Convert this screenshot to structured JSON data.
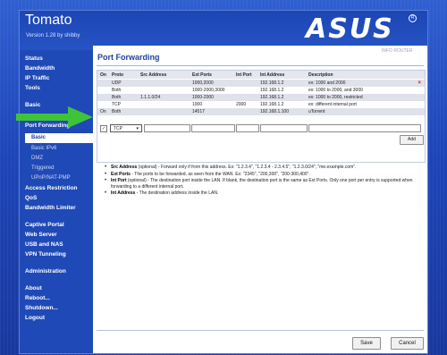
{
  "app": {
    "title": "Tomato",
    "version": "Version 1.28 by shibby",
    "brand": "ASUS"
  },
  "sidebar": {
    "items": [
      {
        "label": "Status"
      },
      {
        "label": "Bandwidth"
      },
      {
        "label": "IP Traffic"
      },
      {
        "label": "Tools"
      },
      {
        "label": "Basic"
      },
      {
        "label": "Port Forwarding"
      },
      {
        "label": "Access Restriction"
      },
      {
        "label": "QoS"
      },
      {
        "label": "Bandwidth Limiter"
      },
      {
        "label": "Captive Portal"
      },
      {
        "label": "Web Server"
      },
      {
        "label": "USB and NAS"
      },
      {
        "label": "VPN Tunneling"
      },
      {
        "label": "Administration"
      },
      {
        "label": "About"
      },
      {
        "label": "Reboot..."
      },
      {
        "label": "Shutdown..."
      },
      {
        "label": "Logout"
      }
    ],
    "subitems": [
      {
        "label": "Basic",
        "active": true
      },
      {
        "label": "Basic IPv6"
      },
      {
        "label": "DMZ"
      },
      {
        "label": "Triggered"
      },
      {
        "label": "UPnP/NAT-PMP"
      }
    ]
  },
  "main": {
    "status": "INFO ROUTER",
    "title": "Port Forwarding",
    "table": {
      "columns": [
        "On",
        "Proto",
        "Src Address",
        "Ext Ports",
        "Int Port",
        "Int Address",
        "Description"
      ],
      "rows": [
        {
          "on": "",
          "proto": "UDP",
          "src": "",
          "ext": "1000,2000",
          "int_port": "",
          "int_addr": "192.168.1.2",
          "desc": "ex: 1000 and 2000",
          "delete": "×"
        },
        {
          "on": "",
          "proto": "Both",
          "src": "",
          "ext": "1000-2000,3000",
          "int_port": "",
          "int_addr": "192.168.1.2",
          "desc": "ex: 1000 to 2000, and 3000",
          "delete": ""
        },
        {
          "on": "",
          "proto": "Both",
          "src": "1.1.1.0/24",
          "ext": "1000-2000",
          "int_port": "",
          "int_addr": "192.168.1.2",
          "desc": "ex: 1000 to 2000, restricted",
          "delete": ""
        },
        {
          "on": "",
          "proto": "TCP",
          "src": "",
          "ext": "1000",
          "int_port": "2000",
          "int_addr": "192.168.1.2",
          "desc": "ex: different internal port",
          "delete": ""
        },
        {
          "on": "On",
          "proto": "Both",
          "src": "",
          "ext": "14517",
          "int_port": "",
          "int_addr": "192.168.1.100",
          "desc": "uTorrent",
          "delete": ""
        }
      ],
      "new_row": {
        "checked_mark": "✓",
        "proto_value": "TCP",
        "caret": "▾"
      },
      "add_label": "Add"
    },
    "notes": [
      {
        "bullet": "•",
        "term": "Src Address",
        "detail": " (optional) - Forward only if from this address. Ex: \"1.2.3.4\", \"1.2.3.4 - 2.3.4.5\", \"1.2.3.0/24\", \"me.example.com\"."
      },
      {
        "bullet": "•",
        "term": "Ext Ports",
        "detail": " - The ports to be forwarded, as seen from the WAN. Ex: \"2345\", \"200,300\", \"200-300,400\"."
      },
      {
        "bullet": "•",
        "term": "Int Port",
        "detail": " (optional) - The destination port inside the LAN. If blank, the destination port is the same as Ext Ports. Only one port per entry is supported when forwarding to a different internal port."
      },
      {
        "bullet": "•",
        "term": "Int Address",
        "detail": " - The destination address inside the LAN."
      }
    ],
    "buttons": {
      "save": "Save",
      "cancel": "Cancel"
    }
  },
  "colors": {
    "background": "#1b3fa0",
    "accent_green": "#3ec43a",
    "title_blue": "#1f3f9f"
  }
}
